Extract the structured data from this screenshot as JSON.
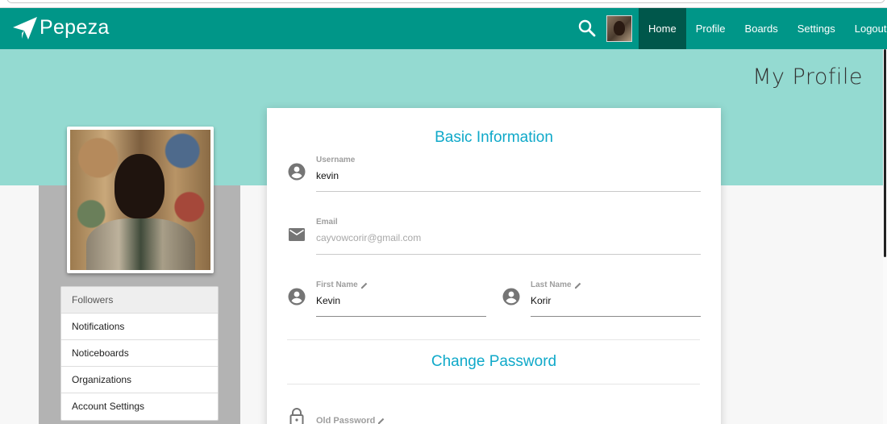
{
  "brand": {
    "name": "Pepeza"
  },
  "nav": {
    "items": [
      {
        "label": "Home",
        "active": true
      },
      {
        "label": "Profile"
      },
      {
        "label": "Boards"
      },
      {
        "label": "Settings"
      },
      {
        "label": "Logout"
      }
    ]
  },
  "page": {
    "title": "My Profile"
  },
  "sidebar": {
    "menu": [
      "Followers",
      "Notifications",
      "Noticeboards",
      "Organizations",
      "Account Settings"
    ]
  },
  "basic_info": {
    "title": "Basic Information",
    "username": {
      "label": "Username",
      "value": "kevin"
    },
    "email": {
      "label": "Email",
      "value": "cayvowcorir@gmail.com"
    },
    "first_name": {
      "label": "First Name",
      "value": "Kevin"
    },
    "last_name": {
      "label": "Last Name",
      "value": "Korir"
    }
  },
  "change_password": {
    "title": "Change Password",
    "old_password": {
      "label": "Old Password"
    }
  },
  "colors": {
    "primary": "#009688",
    "primary_dark": "#00574b",
    "banner": "#94dad1",
    "accent": "#10a9c9"
  }
}
